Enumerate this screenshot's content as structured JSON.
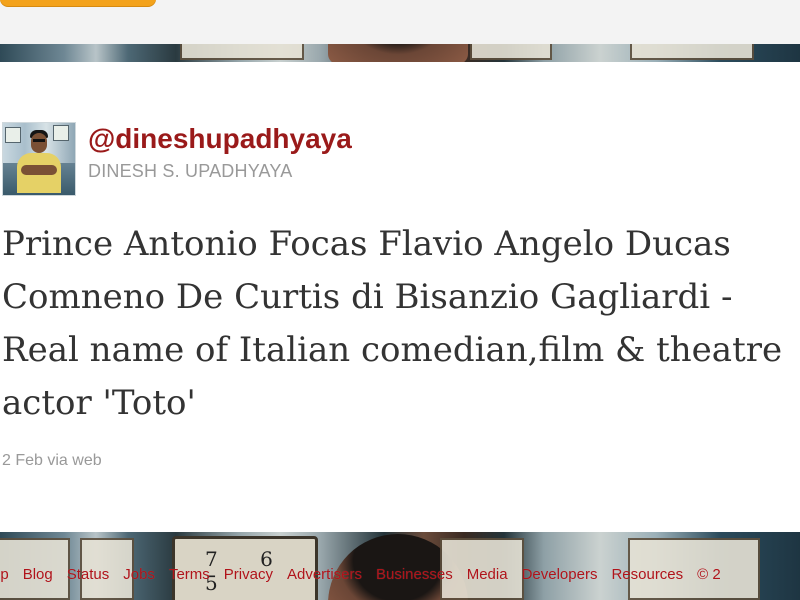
{
  "tweet": {
    "handle": "@dineshupadhyaya",
    "display_name": "DINESH S. UPADHYAYA",
    "text": "Prince Antonio Focas Flavio Angelo Ducas Comneno De Curtis di Bisanzio Gagliardi - Real name of Italian comedian,film & theatre actor 'Toto'",
    "date": "2 Feb",
    "via_prefix": "via",
    "source": "web"
  },
  "background": {
    "clock_digits": "7 6 5"
  },
  "footer": {
    "links": [
      "lp",
      "Blog",
      "Status",
      "Jobs",
      "Terms",
      "Privacy",
      "Advertisers",
      "Businesses",
      "Media",
      "Developers",
      "Resources",
      "© 2"
    ]
  },
  "colors": {
    "handle": "#9a1a1a",
    "footer_link": "#b0131a",
    "muted_text": "#999999",
    "body_text": "#333333",
    "accent_pill": "#f3a21b"
  }
}
